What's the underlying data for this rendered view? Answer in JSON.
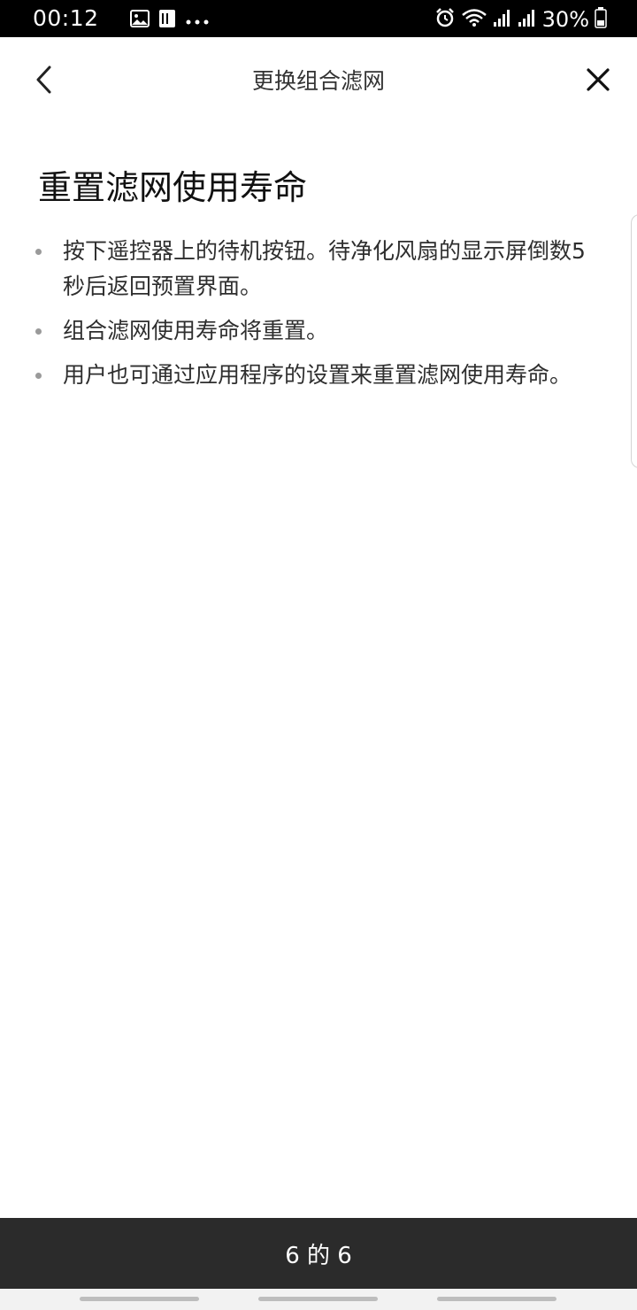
{
  "status_bar": {
    "time": "00:12",
    "left_icons": [
      "image-icon",
      "sim-card-icon",
      "more-dots-icon"
    ],
    "right_icons": [
      "alarm-icon",
      "wifi-icon",
      "signal-icon",
      "signal-icon",
      "battery-icon"
    ],
    "battery_text": "30%"
  },
  "header": {
    "title": "更换组合滤网",
    "back_icon": "chevron-left-icon",
    "close_icon": "close-icon"
  },
  "main": {
    "section_title": "重置滤网使用寿命",
    "bullets": [
      {
        "text": "按下遥控器上的待机按钮。待净化风扇的显示屏倒数5秒后返回预置界面。"
      },
      {
        "text": "组合滤网使用寿命将重置。"
      },
      {
        "text": "用户也可通过应用程序的设置来重置滤网使用寿命。"
      }
    ]
  },
  "footer": {
    "page_indicator": "6 的 6"
  },
  "colors": {
    "status_bar_bg": "#000000",
    "footer_bg": "#2b2b2b",
    "bullet_dot": "#9a9a9a",
    "text_primary": "#111111"
  }
}
